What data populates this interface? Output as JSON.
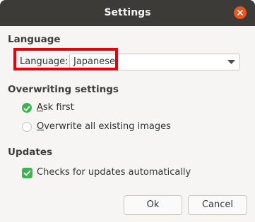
{
  "window": {
    "title": "Settings"
  },
  "language": {
    "heading": "Language",
    "label": "Language:",
    "selected": "Japanese"
  },
  "overwriting": {
    "heading": "Overwriting settings",
    "ask_first": {
      "mnemonic": "A",
      "rest": "sk first",
      "selected": true
    },
    "overwrite_all": {
      "mnemonic": "O",
      "rest": "verwrite all existing images",
      "selected": false
    }
  },
  "updates": {
    "heading": "Updates",
    "check_updates": {
      "label": "Checks for updates automatically",
      "checked": true
    }
  },
  "buttons": {
    "ok": "Ok",
    "cancel": "Cancel"
  },
  "colors": {
    "accent": "#3eb34f",
    "close": "#e95420",
    "highlight": "#e8000b"
  }
}
